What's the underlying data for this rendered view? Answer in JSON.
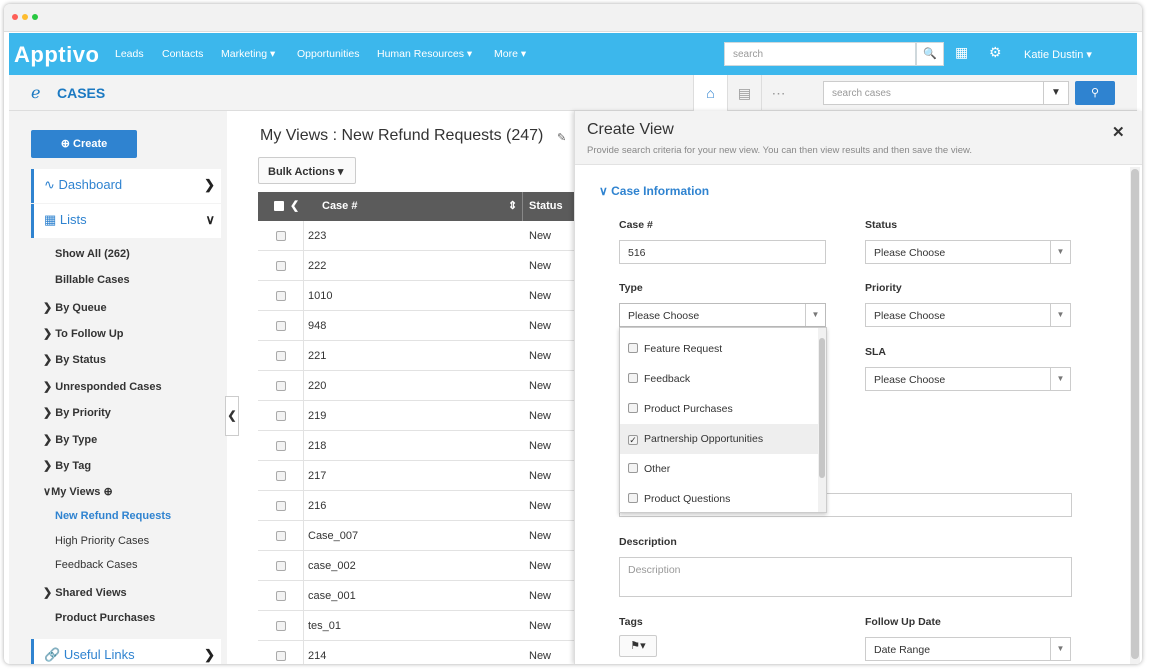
{
  "topbar": {
    "logo": "Apptivo",
    "nav": [
      "Leads",
      "Contacts",
      "Marketing ▾",
      "Opportunities",
      "Human Resources ▾",
      "More ▾"
    ],
    "search_placeholder": "search",
    "user": "Katie Dustin ▾"
  },
  "subbar": {
    "app_title": "CASES",
    "search_placeholder": "search cases"
  },
  "sidebar": {
    "create_label": "Create",
    "dashboard_label": "Dashboard",
    "lists_label": "Lists",
    "links": [
      "Show All (262)",
      "Billable Cases",
      "By Queue",
      "To Follow Up",
      "By Status",
      "Unresponded Cases",
      "By Priority",
      "By Type",
      "By Tag",
      "My Views"
    ],
    "my_views": [
      "New Refund Requests",
      "High Priority Cases",
      "Feedback Cases"
    ],
    "shared_views": "Shared Views",
    "product_purchases": "Product Purchases",
    "useful_links": "Useful Links"
  },
  "list": {
    "title": "My Views : New Refund Requests (247)",
    "bulk_actions": "Bulk Actions ▾",
    "col_case": "Case #",
    "col_status": "Status",
    "rows": [
      {
        "case": "223",
        "status": "New"
      },
      {
        "case": "222",
        "status": "New"
      },
      {
        "case": "1010",
        "status": "New"
      },
      {
        "case": "948",
        "status": "New"
      },
      {
        "case": "221",
        "status": "New"
      },
      {
        "case": "220",
        "status": "New"
      },
      {
        "case": "219",
        "status": "New"
      },
      {
        "case": "218",
        "status": "New"
      },
      {
        "case": "217",
        "status": "New"
      },
      {
        "case": "216",
        "status": "New"
      },
      {
        "case": "Case_007",
        "status": "New"
      },
      {
        "case": "case_002",
        "status": "New"
      },
      {
        "case": "case_001",
        "status": "New"
      },
      {
        "case": "tes_01",
        "status": "New"
      },
      {
        "case": "214",
        "status": "New"
      }
    ]
  },
  "panel": {
    "title": "Create View",
    "subtitle": "Provide search criteria for your new view. You can then view results and then save the view.",
    "section": "Case Information",
    "case_label": "Case #",
    "case_value": "516",
    "status_label": "Status",
    "status_value": "Please Choose",
    "type_label": "Type",
    "type_value": "Please Choose",
    "priority_label": "Priority",
    "priority_value": "Please Choose",
    "sla_label": "SLA",
    "sla_value": "Please Choose",
    "type_options": [
      {
        "label": "Feature Request",
        "checked": false
      },
      {
        "label": "Feedback",
        "checked": false
      },
      {
        "label": "Product Purchases",
        "checked": false
      },
      {
        "label": "Partnership Opportunities",
        "checked": true
      },
      {
        "label": "Other",
        "checked": false
      },
      {
        "label": "Product Questions",
        "checked": false
      }
    ],
    "description_label": "Description",
    "description_placeholder": "Description",
    "tags_label": "Tags",
    "followup_label": "Follow Up Date",
    "followup_value": "Date Range"
  },
  "colors": {
    "brand": "#3cb7ec",
    "accent": "#2f83d0"
  }
}
